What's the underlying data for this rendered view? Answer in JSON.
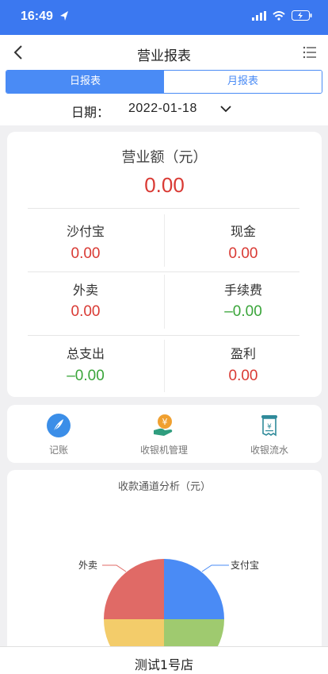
{
  "status": {
    "time": "16:49"
  },
  "nav": {
    "title": "营业报表"
  },
  "tabs": [
    {
      "label": "日报表",
      "active": true
    },
    {
      "label": "月报表",
      "active": false
    }
  ],
  "date": {
    "label": "日期：",
    "value": "2022-01-18"
  },
  "summary": {
    "total_label": "营业额（元）",
    "total_value": "0.00",
    "metrics": [
      {
        "label": "沙付宝",
        "value": "0.00"
      },
      {
        "label": "现金",
        "value": "0.00"
      },
      {
        "label": "外卖",
        "value": "0.00"
      },
      {
        "label": "手续费",
        "value": "–0.00"
      },
      {
        "label": "总支出",
        "value": "–0.00"
      },
      {
        "label": "盈利",
        "value": "0.00"
      }
    ]
  },
  "quick_actions": [
    {
      "label": "记账",
      "icon": "pen-icon"
    },
    {
      "label": "收银机管理",
      "icon": "cashier-icon"
    },
    {
      "label": "收银流水",
      "icon": "receipt-icon"
    }
  ],
  "chart": {
    "title": "收款通道分析（元）",
    "labels": {
      "alipay": "支付宝",
      "takeout": "外卖"
    }
  },
  "chart_data": {
    "type": "pie",
    "title": "收款通道分析（元）",
    "slices": [
      {
        "name": "支付宝",
        "value": 1,
        "color": "#4a8bf5"
      },
      {
        "name": "",
        "value": 1,
        "color": "#9fca6f"
      },
      {
        "name": "",
        "value": 1,
        "color": "#f3cc6a"
      },
      {
        "name": "外卖",
        "value": 1,
        "color": "#e06a66"
      }
    ]
  },
  "footer": {
    "store_name": "测试1号店"
  },
  "colors": {
    "primary": "#3b78f0",
    "accent": "#4a8bf5",
    "negative": "#d93a34",
    "positive": "#3aa53a"
  }
}
